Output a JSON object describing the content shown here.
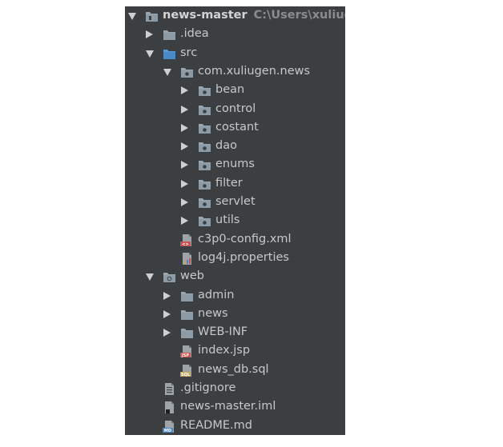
{
  "project": {
    "name": "news-master",
    "path": "C:\\Users\\xuliugen\\"
  },
  "tree": [
    {
      "label": "news-master",
      "depth": 0,
      "arrow": "down",
      "icon": "project-folder-icon",
      "kind": "root"
    },
    {
      "label": ".idea",
      "depth": 1,
      "arrow": "right",
      "icon": "folder-icon"
    },
    {
      "label": "src",
      "depth": 1,
      "arrow": "down",
      "icon": "source-folder-icon"
    },
    {
      "label": "com.xuliugen.news",
      "depth": 2,
      "arrow": "down",
      "icon": "package-icon"
    },
    {
      "label": "bean",
      "depth": 3,
      "arrow": "right",
      "icon": "package-icon"
    },
    {
      "label": "control",
      "depth": 3,
      "arrow": "right",
      "icon": "package-icon"
    },
    {
      "label": "costant",
      "depth": 3,
      "arrow": "right",
      "icon": "package-icon"
    },
    {
      "label": "dao",
      "depth": 3,
      "arrow": "right",
      "icon": "package-icon"
    },
    {
      "label": "enums",
      "depth": 3,
      "arrow": "right",
      "icon": "package-icon"
    },
    {
      "label": "filter",
      "depth": 3,
      "arrow": "right",
      "icon": "package-icon"
    },
    {
      "label": "servlet",
      "depth": 3,
      "arrow": "right",
      "icon": "package-icon"
    },
    {
      "label": "utils",
      "depth": 3,
      "arrow": "right",
      "icon": "package-icon"
    },
    {
      "label": "c3p0-config.xml",
      "depth": 2,
      "arrow": "none",
      "icon": "xml-file-icon"
    },
    {
      "label": "log4j.properties",
      "depth": 2,
      "arrow": "none",
      "icon": "properties-file-icon"
    },
    {
      "label": "web",
      "depth": 1,
      "arrow": "down",
      "icon": "web-folder-icon"
    },
    {
      "label": "admin",
      "depth": 2,
      "arrow": "right",
      "icon": "folder-icon"
    },
    {
      "label": "news",
      "depth": 2,
      "arrow": "right",
      "icon": "folder-icon"
    },
    {
      "label": "WEB-INF",
      "depth": 2,
      "arrow": "right",
      "icon": "folder-icon"
    },
    {
      "label": "index.jsp",
      "depth": 2,
      "arrow": "none",
      "icon": "jsp-file-icon"
    },
    {
      "label": "news_db.sql",
      "depth": 2,
      "arrow": "none",
      "icon": "sql-file-icon"
    },
    {
      "label": ".gitignore",
      "depth": 1,
      "arrow": "none",
      "icon": "text-file-icon"
    },
    {
      "label": "news-master.iml",
      "depth": 1,
      "arrow": "none",
      "icon": "iml-file-icon"
    },
    {
      "label": "README.md",
      "depth": 1,
      "arrow": "none",
      "icon": "markdown-file-icon"
    }
  ],
  "colors": {
    "background": "#3c3f41",
    "text": "#c8c8c8",
    "folder": "#8d9ba6",
    "source_folder": "#4a88c7",
    "xml_badge": "#c75450",
    "sql_badge": "#c7a94a",
    "jsp_badge": "#c75450"
  }
}
